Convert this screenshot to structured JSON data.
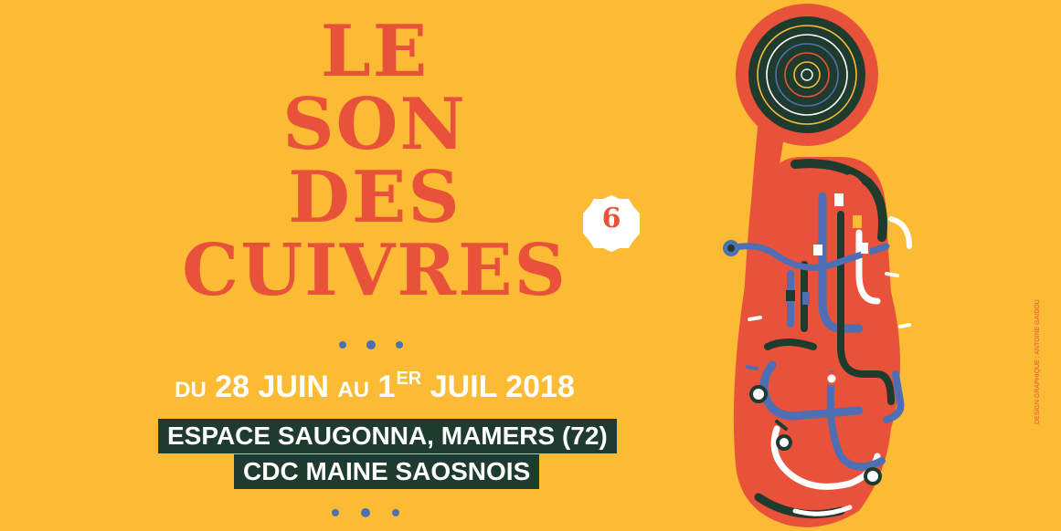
{
  "title": {
    "line1": "LE",
    "line2": "SON",
    "line3": "DES",
    "line4": "CUIVRES"
  },
  "edition": "6",
  "dates": {
    "du": "DU",
    "start": "28 JUIN",
    "au": "AU",
    "end_day": "1",
    "end_suffix": "ER",
    "end_rest": "JUIL 2018"
  },
  "venue": {
    "line1": "ESPACE SAUGONNA, MAMERS (72)",
    "line2": "CDC MAINE SAOSNOIS"
  },
  "credit": "DESIGN GRAPHIQUE : ANTOINE GAIDOU",
  "colors": {
    "background": "#fbbb34",
    "title": "#e8523a",
    "accent_blue": "#4e6fb3",
    "venue_box": "#1f3b2e"
  },
  "illustration": "tuba-icon"
}
